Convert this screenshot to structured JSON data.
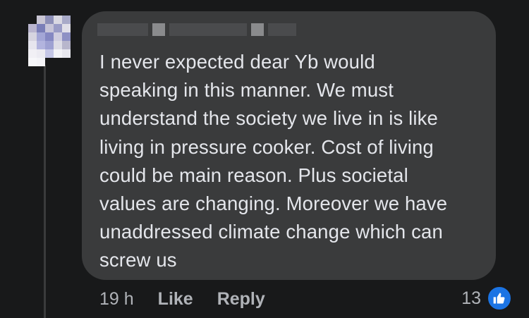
{
  "comment": {
    "text": "I never expected dear Yb would\nspeaking in this manner. We must\nunderstand the society we live in is like\nliving in pressure cooker. Cost of living\ncould be main reason. Plus societal\nvalues are changing. Moreover we have\nunaddressed climate change which can\nscrew us",
    "timestamp": "19 h",
    "like_label": "Like",
    "reply_label": "Reply",
    "reaction_count": "13",
    "reaction_icon": "thumbs-up-icon"
  },
  "colors": {
    "background": "#18191a",
    "bubble": "#3a3b3c",
    "text": "#e4e6eb",
    "secondary_text": "#b0b3b8",
    "like_blue": "#1b74e4"
  }
}
